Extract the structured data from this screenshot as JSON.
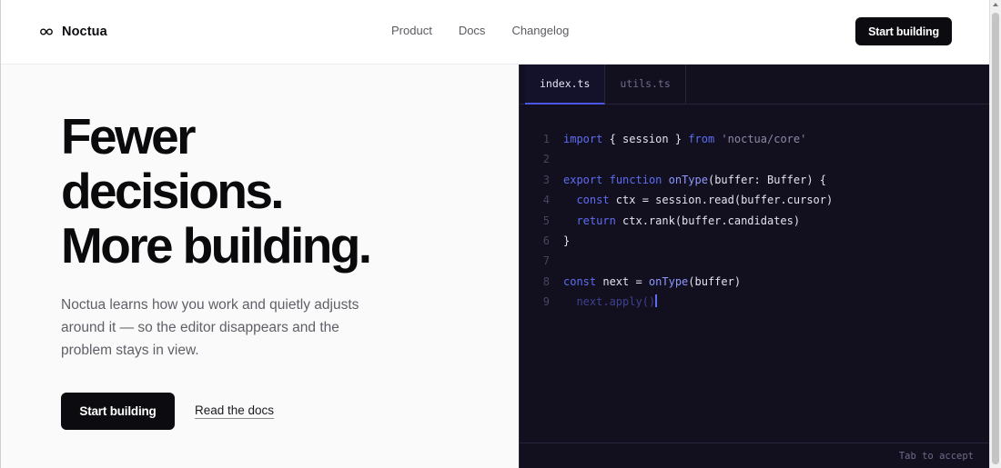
{
  "header": {
    "brand": "Noctua",
    "nav": [
      "Product",
      "Docs",
      "Changelog"
    ],
    "cta_label": "Start building"
  },
  "hero": {
    "title_lines": [
      "Fewer",
      "decisions.",
      "More building."
    ],
    "description": "Noctua learns how you work and quietly adjusts around it — so the editor disappears and the problem stays in view.",
    "primary_cta": "Start building",
    "secondary_cta": "Read the docs"
  },
  "editor": {
    "tabs": [
      {
        "label": "index.ts",
        "active": true
      },
      {
        "label": "utils.ts",
        "active": false
      }
    ],
    "lines": [
      {
        "n": "1",
        "tokens": [
          [
            "k",
            "import"
          ],
          [
            "",
            " { session } "
          ],
          [
            "k",
            "from"
          ],
          [
            "",
            " "
          ],
          [
            "s",
            "'noctua/core'"
          ]
        ]
      },
      {
        "n": "2",
        "tokens": []
      },
      {
        "n": "3",
        "tokens": [
          [
            "k",
            "export"
          ],
          [
            "",
            " "
          ],
          [
            "k",
            "function"
          ],
          [
            "",
            " "
          ],
          [
            "f",
            "onType"
          ],
          [
            "",
            "(buffer: Buffer) {"
          ]
        ]
      },
      {
        "n": "4",
        "tokens": [
          [
            "",
            "  "
          ],
          [
            "k",
            "const"
          ],
          [
            "",
            " ctx = session.read(buffer.cursor)"
          ]
        ]
      },
      {
        "n": "5",
        "tokens": [
          [
            "",
            "  "
          ],
          [
            "k",
            "return"
          ],
          [
            "",
            " ctx.rank(buffer.candidates)"
          ]
        ]
      },
      {
        "n": "6",
        "tokens": [
          [
            "",
            "}"
          ]
        ]
      },
      {
        "n": "7",
        "tokens": []
      },
      {
        "n": "8",
        "tokens": [
          [
            "k",
            "const"
          ],
          [
            "",
            " next = "
          ],
          [
            "f",
            "onType"
          ],
          [
            "",
            "(buffer)"
          ]
        ]
      },
      {
        "n": "9",
        "tokens": [
          [
            "ghost",
            "  next.apply()"
          ],
          [
            "caret",
            ""
          ]
        ]
      }
    ],
    "status": "Tab to accept"
  },
  "colors": {
    "ink": "#0c0c10",
    "editor_bg": "#12101f",
    "accent": "#5e6cf2"
  },
  "icons": {
    "brand": "owl-eyes-icon"
  }
}
